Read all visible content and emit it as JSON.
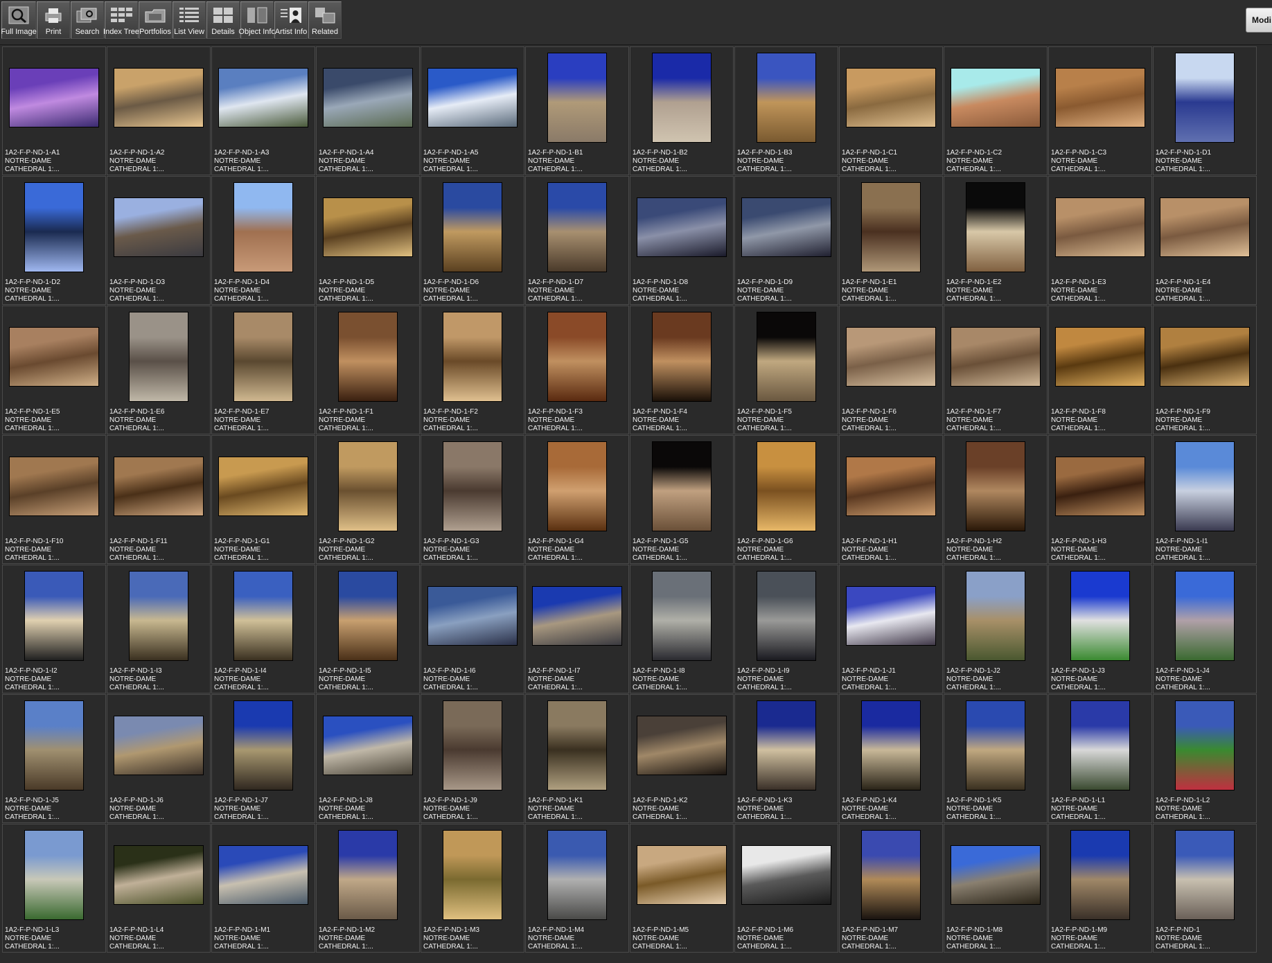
{
  "toolbar": {
    "buttons": [
      {
        "label": "Full Image",
        "icon": "magnifier-icon"
      },
      {
        "label": "Print",
        "icon": "printer-icon"
      },
      {
        "label": "Search",
        "icon": "search-thumbnails-icon"
      },
      {
        "label": "Index Tree",
        "icon": "index-tree-icon"
      },
      {
        "label": "Portfolios",
        "icon": "portfolio-folder-icon"
      },
      {
        "label": "List View",
        "icon": "list-view-icon"
      },
      {
        "label": "Details",
        "icon": "details-grid-icon"
      },
      {
        "label": "Object Info",
        "icon": "object-info-icon"
      },
      {
        "label": "Artist  Info",
        "icon": "artist-portrait-icon"
      },
      {
        "label": "Related",
        "icon": "related-squares-icon"
      }
    ],
    "modify_label": "Modi"
  },
  "colors": {
    "background": "#2b2b2b",
    "cell_border": "#4a4a4a",
    "text": "#f0f0f0"
  },
  "grid": {
    "line2": "NOTRE-DAME",
    "line3": "CATHEDRAL 1:...",
    "items": [
      {
        "id": "1A2-F-P-ND-1-A1",
        "orient": "land",
        "palette": [
          "#6a3fb8",
          "#c08ae0",
          "#3a2a70"
        ]
      },
      {
        "id": "1A2-F-P-ND-1-A2",
        "orient": "land",
        "palette": [
          "#c9a26a",
          "#6b5a45",
          "#e8c690"
        ]
      },
      {
        "id": "1A2-F-P-ND-1-A3",
        "orient": "land",
        "palette": [
          "#5a7fc0",
          "#dfe6f0",
          "#4a5a3a"
        ]
      },
      {
        "id": "1A2-F-P-ND-1-A4",
        "orient": "land",
        "palette": [
          "#3a4a6a",
          "#9aa8b8",
          "#5a6a50"
        ]
      },
      {
        "id": "1A2-F-P-ND-1-A5",
        "orient": "land",
        "palette": [
          "#2a5ac8",
          "#e6ecf6",
          "#5a6a7a"
        ]
      },
      {
        "id": "1A2-F-P-ND-1-B1",
        "orient": "port",
        "palette": [
          "#2a3ec0",
          "#b09a78",
          "#8a7a68"
        ]
      },
      {
        "id": "1A2-F-P-ND-1-B2",
        "orient": "port",
        "palette": [
          "#1a2aa8",
          "#b0a090",
          "#d0c4b0"
        ]
      },
      {
        "id": "1A2-F-P-ND-1-B3",
        "orient": "port",
        "palette": [
          "#3a55c0",
          "#c0955a",
          "#7a5a30"
        ]
      },
      {
        "id": "1A2-F-P-ND-1-C1",
        "orient": "land",
        "palette": [
          "#c89a60",
          "#8a6a40",
          "#e0c090"
        ]
      },
      {
        "id": "1A2-F-P-ND-1-C2",
        "orient": "land",
        "palette": [
          "#a8eaea",
          "#c88a60",
          "#8a5a3a"
        ]
      },
      {
        "id": "1A2-F-P-ND-1-C3",
        "orient": "land",
        "palette": [
          "#b8804a",
          "#8a5a30",
          "#e0b080"
        ]
      },
      {
        "id": "1A2-F-P-ND-1-D1",
        "orient": "port",
        "palette": [
          "#c8d8f0",
          "#2a3a90",
          "#6070b0"
        ]
      },
      {
        "id": "1A2-F-P-ND-1-D2",
        "orient": "port",
        "palette": [
          "#3a6ad8",
          "#1a2a50",
          "#a0b8f0"
        ]
      },
      {
        "id": "1A2-F-P-ND-1-D3",
        "orient": "land",
        "palette": [
          "#9ab0e0",
          "#6a5a4a",
          "#3a3a40"
        ]
      },
      {
        "id": "1A2-F-P-ND-1-D4",
        "orient": "port",
        "palette": [
          "#90b8f0",
          "#a07050",
          "#c89a78"
        ]
      },
      {
        "id": "1A2-F-P-ND-1-D5",
        "orient": "land",
        "palette": [
          "#b8904a",
          "#5a4020",
          "#e0c080"
        ]
      },
      {
        "id": "1A2-F-P-ND-1-D6",
        "orient": "port",
        "palette": [
          "#2a4aa0",
          "#c09a60",
          "#5a4020"
        ]
      },
      {
        "id": "1A2-F-P-ND-1-D7",
        "orient": "port",
        "palette": [
          "#2a4aa8",
          "#a89070",
          "#4a3a2a"
        ]
      },
      {
        "id": "1A2-F-P-ND-1-D8",
        "orient": "land",
        "palette": [
          "#3a4a78",
          "#8a90a8",
          "#1a1a2a"
        ]
      },
      {
        "id": "1A2-F-P-ND-1-D9",
        "orient": "land",
        "palette": [
          "#3a4a70",
          "#9098a8",
          "#202030"
        ]
      },
      {
        "id": "1A2-F-P-ND-1-E1",
        "orient": "port",
        "palette": [
          "#8a7050",
          "#4a3020",
          "#b09878"
        ]
      },
      {
        "id": "1A2-F-P-ND-1-E2",
        "orient": "port",
        "palette": [
          "#0a0a0a",
          "#d8c8a8",
          "#806040"
        ]
      },
      {
        "id": "1A2-F-P-ND-1-E3",
        "orient": "land",
        "palette": [
          "#b89068",
          "#7a5a40",
          "#d8b890"
        ]
      },
      {
        "id": "1A2-F-P-ND-1-E4",
        "orient": "land",
        "palette": [
          "#b89068",
          "#7a5a40",
          "#e0c098"
        ]
      },
      {
        "id": "1A2-F-P-ND-1-E5",
        "orient": "land",
        "palette": [
          "#a88060",
          "#6a4a30",
          "#d0b088"
        ]
      },
      {
        "id": "1A2-F-P-ND-1-E6",
        "orient": "port",
        "palette": [
          "#9a9288",
          "#5a5048",
          "#c0b8a8"
        ]
      },
      {
        "id": "1A2-F-P-ND-1-E7",
        "orient": "port",
        "palette": [
          "#a88a68",
          "#5a4830",
          "#d0b890"
        ]
      },
      {
        "id": "1A2-F-P-ND-1-F1",
        "orient": "port",
        "palette": [
          "#7a5030",
          "#c09060",
          "#3a2010"
        ]
      },
      {
        "id": "1A2-F-P-ND-1-F2",
        "orient": "port",
        "palette": [
          "#c09868",
          "#6a4a28",
          "#e0c090"
        ]
      },
      {
        "id": "1A2-F-P-ND-1-F3",
        "orient": "port",
        "palette": [
          "#8a4a28",
          "#c09060",
          "#5a2a10"
        ]
      },
      {
        "id": "1A2-F-P-ND-1-F4",
        "orient": "port",
        "palette": [
          "#6a3a20",
          "#c09060",
          "#1a1008"
        ]
      },
      {
        "id": "1A2-F-P-ND-1-F5",
        "orient": "port",
        "palette": [
          "#0a0808",
          "#c0a880",
          "#6a5840"
        ]
      },
      {
        "id": "1A2-F-P-ND-1-F6",
        "orient": "land",
        "palette": [
          "#b89878",
          "#7a6048",
          "#d8c0a0"
        ]
      },
      {
        "id": "1A2-F-P-ND-1-F7",
        "orient": "land",
        "palette": [
          "#a88868",
          "#6a5038",
          "#d0b898"
        ]
      },
      {
        "id": "1A2-F-P-ND-1-F8",
        "orient": "land",
        "palette": [
          "#c08840",
          "#5a3a10",
          "#e0b060"
        ]
      },
      {
        "id": "1A2-F-P-ND-1-F9",
        "orient": "land",
        "palette": [
          "#b08040",
          "#4a3010",
          "#d8b070"
        ]
      },
      {
        "id": "1A2-F-P-ND-1-F10",
        "orient": "land",
        "palette": [
          "#a07850",
          "#5a4028",
          "#c8a078"
        ]
      },
      {
        "id": "1A2-F-P-ND-1-F11",
        "orient": "land",
        "palette": [
          "#a07850",
          "#4a3018",
          "#d0a880"
        ]
      },
      {
        "id": "1A2-F-P-ND-1-G1",
        "orient": "land",
        "palette": [
          "#c89a50",
          "#6a4a20",
          "#e0b870"
        ]
      },
      {
        "id": "1A2-F-P-ND-1-G2",
        "orient": "port",
        "palette": [
          "#c09a60",
          "#6a5030",
          "#e0c088"
        ]
      },
      {
        "id": "1A2-F-P-ND-1-G3",
        "orient": "port",
        "palette": [
          "#8a7868",
          "#4a3a30",
          "#b0a090"
        ]
      },
      {
        "id": "1A2-F-P-ND-1-G4",
        "orient": "port",
        "palette": [
          "#a86a38",
          "#d0a070",
          "#5a3010"
        ]
      },
      {
        "id": "1A2-F-P-ND-1-G5",
        "orient": "port",
        "palette": [
          "#0a0808",
          "#c0a080",
          "#6a5038"
        ]
      },
      {
        "id": "1A2-F-P-ND-1-G6",
        "orient": "port",
        "palette": [
          "#c89040",
          "#7a5020",
          "#e8b868"
        ]
      },
      {
        "id": "1A2-F-P-ND-1-H1",
        "orient": "land",
        "palette": [
          "#b07848",
          "#5a3820",
          "#d0a070"
        ]
      },
      {
        "id": "1A2-F-P-ND-1-H2",
        "orient": "port",
        "palette": [
          "#6a4028",
          "#b08860",
          "#2a1808"
        ]
      },
      {
        "id": "1A2-F-P-ND-1-H3",
        "orient": "land",
        "palette": [
          "#9a6a40",
          "#3a2010",
          "#c09060"
        ]
      },
      {
        "id": "1A2-F-P-ND-1-I1",
        "orient": "port",
        "palette": [
          "#5a8ad8",
          "#c8d0e0",
          "#3a3a50"
        ]
      },
      {
        "id": "1A2-F-P-ND-1-I2",
        "orient": "port",
        "palette": [
          "#3a5ab8",
          "#e0d0b0",
          "#202020"
        ]
      },
      {
        "id": "1A2-F-P-ND-1-I3",
        "orient": "port",
        "palette": [
          "#4a6ab8",
          "#c8b890",
          "#3a3020"
        ]
      },
      {
        "id": "1A2-F-P-ND-1-I4",
        "orient": "port",
        "palette": [
          "#3a60c0",
          "#d0c098",
          "#3a3020"
        ]
      },
      {
        "id": "1A2-F-P-ND-1-I5",
        "orient": "port",
        "palette": [
          "#2a4aa0",
          "#c8a070",
          "#4a3018"
        ]
      },
      {
        "id": "1A2-F-P-ND-1-I6",
        "orient": "land",
        "palette": [
          "#3a5a98",
          "#8aa0c0",
          "#2a3048"
        ]
      },
      {
        "id": "1A2-F-P-ND-1-I7",
        "orient": "land",
        "palette": [
          "#1a3ab0",
          "#a89880",
          "#3a3a40"
        ]
      },
      {
        "id": "1A2-F-P-ND-1-I8",
        "orient": "port",
        "palette": [
          "#6a7078",
          "#b0b0a8",
          "#2a2a30"
        ]
      },
      {
        "id": "1A2-F-P-ND-1-I9",
        "orient": "port",
        "palette": [
          "#4a5058",
          "#9a9a98",
          "#1a1a20"
        ]
      },
      {
        "id": "1A2-F-P-ND-1-J1",
        "orient": "land",
        "palette": [
          "#3a48c0",
          "#e8e8f0",
          "#403848"
        ]
      },
      {
        "id": "1A2-F-P-ND-1-J2",
        "orient": "port",
        "palette": [
          "#8aa0c8",
          "#a89068",
          "#4a5830"
        ]
      },
      {
        "id": "1A2-F-P-ND-1-J3",
        "orient": "port",
        "palette": [
          "#1a3ad0",
          "#e0e0e0",
          "#3a8a30"
        ]
      },
      {
        "id": "1A2-F-P-ND-1-J4",
        "orient": "port",
        "palette": [
          "#3a6ad8",
          "#b0a0a8",
          "#3a6a30"
        ]
      },
      {
        "id": "1A2-F-P-ND-1-J5",
        "orient": "port",
        "palette": [
          "#5a80c8",
          "#a09070",
          "#4a3a28"
        ]
      },
      {
        "id": "1A2-F-P-ND-1-J6",
        "orient": "land",
        "palette": [
          "#7a8ab0",
          "#b09870",
          "#3a3028"
        ]
      },
      {
        "id": "1A2-F-P-ND-1-J7",
        "orient": "port",
        "palette": [
          "#1a3ab0",
          "#a89870",
          "#302820"
        ]
      },
      {
        "id": "1A2-F-P-ND-1-J8",
        "orient": "land",
        "palette": [
          "#2a50c0",
          "#c0b8a8",
          "#4a4438"
        ]
      },
      {
        "id": "1A2-F-P-ND-1-J9",
        "orient": "port",
        "palette": [
          "#7a6a58",
          "#4a3a30",
          "#a89888"
        ]
      },
      {
        "id": "1A2-F-P-ND-1-K1",
        "orient": "port",
        "palette": [
          "#8a7a60",
          "#3a3020",
          "#b0a080"
        ]
      },
      {
        "id": "1A2-F-P-ND-1-K2",
        "orient": "land",
        "palette": [
          "#4a4038",
          "#a08868",
          "#1a1410"
        ]
      },
      {
        "id": "1A2-F-P-ND-1-K3",
        "orient": "port",
        "palette": [
          "#1a2a90",
          "#d0c0a0",
          "#3a3028"
        ]
      },
      {
        "id": "1A2-F-P-ND-1-K4",
        "orient": "port",
        "palette": [
          "#1a2aa0",
          "#c8b898",
          "#2a2418"
        ]
      },
      {
        "id": "1A2-F-P-ND-1-K5",
        "orient": "port",
        "palette": [
          "#2a4ab0",
          "#c0a880",
          "#3a3020"
        ]
      },
      {
        "id": "1A2-F-P-ND-1-L1",
        "orient": "port",
        "palette": [
          "#2a3aa8",
          "#d8d8d8",
          "#3a4a30"
        ]
      },
      {
        "id": "1A2-F-P-ND-1-L2",
        "orient": "port",
        "palette": [
          "#3a5ab8",
          "#3a8a30",
          "#c03040"
        ]
      },
      {
        "id": "1A2-F-P-ND-1-L3",
        "orient": "port",
        "palette": [
          "#7a9ad0",
          "#c8c8b8",
          "#3a6a30"
        ]
      },
      {
        "id": "1A2-F-P-ND-1-L4",
        "orient": "land",
        "palette": [
          "#2a3018",
          "#c0b098",
          "#4a5028"
        ]
      },
      {
        "id": "1A2-F-P-ND-1-M1",
        "orient": "land",
        "palette": [
          "#2a4ab8",
          "#c8c0b0",
          "#4a5a6a"
        ]
      },
      {
        "id": "1A2-F-P-ND-1-M2",
        "orient": "port",
        "palette": [
          "#2a3aa8",
          "#c0a888",
          "#6a5a48"
        ]
      },
      {
        "id": "1A2-F-P-ND-1-M3",
        "orient": "port",
        "palette": [
          "#c09858",
          "#7a6a30",
          "#e0c080"
        ]
      },
      {
        "id": "1A2-F-P-ND-1-M4",
        "orient": "port",
        "palette": [
          "#3a5ab0",
          "#b0b0b0",
          "#4a4a48"
        ]
      },
      {
        "id": "1A2-F-P-ND-1-M5",
        "orient": "land",
        "palette": [
          "#c8a880",
          "#7a5a28",
          "#e8d0b0"
        ]
      },
      {
        "id": "1A2-F-P-ND-1-M6",
        "orient": "land",
        "palette": [
          "#e8e8e8",
          "#5a5a5a",
          "#1a1a1a"
        ]
      },
      {
        "id": "1A2-F-P-ND-1-M7",
        "orient": "port",
        "palette": [
          "#3a4ab0",
          "#b08a58",
          "#1a1410"
        ]
      },
      {
        "id": "1A2-F-P-ND-1-M8",
        "orient": "land",
        "palette": [
          "#3a6ad8",
          "#8a8070",
          "#2a2418"
        ]
      },
      {
        "id": "1A2-F-P-ND-1-M9",
        "orient": "port",
        "palette": [
          "#1a3ab0",
          "#a08868",
          "#3a3028"
        ]
      },
      {
        "id": "1A2-F-P-ND-1",
        "orient": "port",
        "palette": [
          "#3a5ab8",
          "#c8c0b0",
          "#6a6058"
        ]
      }
    ]
  }
}
